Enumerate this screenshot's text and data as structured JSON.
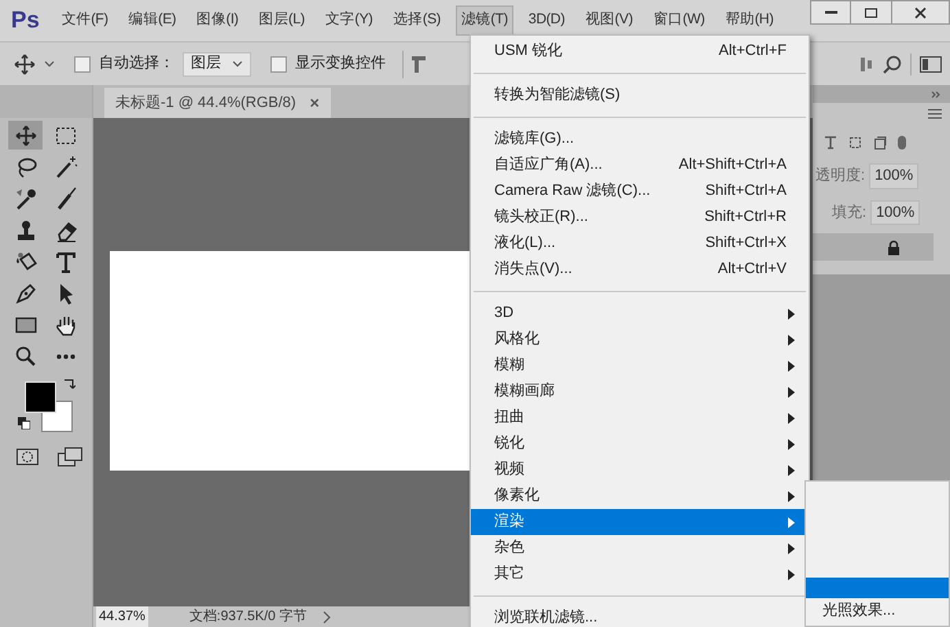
{
  "menubar": {
    "logo": "Ps",
    "items": [
      {
        "label": "文件(F)",
        "selected": false
      },
      {
        "label": "编辑(E)",
        "selected": false
      },
      {
        "label": "图像(I)",
        "selected": false
      },
      {
        "label": "图层(L)",
        "selected": false
      },
      {
        "label": "文字(Y)",
        "selected": false
      },
      {
        "label": "选择(S)",
        "selected": false
      },
      {
        "label": "滤镜(T)",
        "selected": true
      },
      {
        "label": "3D(D)",
        "selected": false
      },
      {
        "label": "视图(V)",
        "selected": false
      },
      {
        "label": "窗口(W)",
        "selected": false
      },
      {
        "label": "帮助(H)",
        "selected": false
      }
    ]
  },
  "options_bar": {
    "auto_select": {
      "label": "自动选择：",
      "checked": false
    },
    "layer_select": {
      "value": "图层"
    },
    "show_transform": {
      "label": "显示变换控件",
      "checked": false
    }
  },
  "document_tab": {
    "title": "未标题-1 @ 44.4%(RGB/8)",
    "close": "×"
  },
  "tools": [
    {
      "kind": "move",
      "selected": true
    },
    {
      "kind": "marquee",
      "selected": false
    },
    {
      "kind": "lasso",
      "selected": false
    },
    {
      "kind": "wand",
      "selected": false
    },
    {
      "kind": "eyedropper",
      "selected": false
    },
    {
      "kind": "brush",
      "selected": false
    },
    {
      "kind": "stamp",
      "selected": false
    },
    {
      "kind": "eraser",
      "selected": false
    },
    {
      "kind": "bucket",
      "selected": false
    },
    {
      "kind": "type",
      "selected": false
    },
    {
      "kind": "pen",
      "selected": false
    },
    {
      "kind": "arrow",
      "selected": false
    },
    {
      "kind": "rect",
      "selected": false
    },
    {
      "kind": "hand",
      "selected": false
    },
    {
      "kind": "zoom",
      "selected": false
    },
    {
      "kind": "more",
      "selected": false
    }
  ],
  "layers_panel": {
    "opacity": {
      "label": "透明度:",
      "value": "100%"
    },
    "fill": {
      "label": "填充:",
      "value": "100%"
    }
  },
  "status_bar": {
    "zoom": "44.37%",
    "doc_info": "文档:937.5K/0 字节"
  },
  "filter_menu": {
    "groups": [
      [
        {
          "label": "USM 锐化",
          "shortcut": "Alt+Ctrl+F",
          "submenu": false,
          "selected": false
        }
      ],
      [
        {
          "label": "转换为智能滤镜(S)",
          "submenu": false,
          "selected": false
        }
      ],
      [
        {
          "label": "滤镜库(G)...",
          "submenu": false,
          "selected": false
        },
        {
          "label": "自适应广角(A)...",
          "shortcut": "Alt+Shift+Ctrl+A",
          "submenu": false,
          "selected": false
        },
        {
          "label": "Camera Raw 滤镜(C)...",
          "shortcut": "Shift+Ctrl+A",
          "submenu": false,
          "selected": false
        },
        {
          "label": "镜头校正(R)...",
          "shortcut": "Shift+Ctrl+R",
          "submenu": false,
          "selected": false
        },
        {
          "label": "液化(L)...",
          "shortcut": "Shift+Ctrl+X",
          "submenu": false,
          "selected": false
        },
        {
          "label": "消失点(V)...",
          "shortcut": "Alt+Ctrl+V",
          "submenu": false,
          "selected": false
        }
      ],
      [
        {
          "label": "3D",
          "submenu": true,
          "selected": false
        },
        {
          "label": "风格化",
          "submenu": true,
          "selected": false
        },
        {
          "label": "模糊",
          "submenu": true,
          "selected": false
        },
        {
          "label": "模糊画廊",
          "submenu": true,
          "selected": false
        },
        {
          "label": "扭曲",
          "submenu": true,
          "selected": false
        },
        {
          "label": "锐化",
          "submenu": true,
          "selected": false
        },
        {
          "label": "视频",
          "submenu": true,
          "selected": false
        },
        {
          "label": "像素化",
          "submenu": true,
          "selected": false
        },
        {
          "label": "渲染",
          "submenu": true,
          "selected": true
        },
        {
          "label": "杂色",
          "submenu": true,
          "selected": false
        },
        {
          "label": "其它",
          "submenu": true,
          "selected": false
        }
      ],
      [
        {
          "label": "浏览联机滤镜...",
          "submenu": false,
          "selected": false
        }
      ]
    ]
  },
  "submenu": {
    "items": [
      {
        "label": "光照效果...",
        "selected": false
      }
    ]
  }
}
